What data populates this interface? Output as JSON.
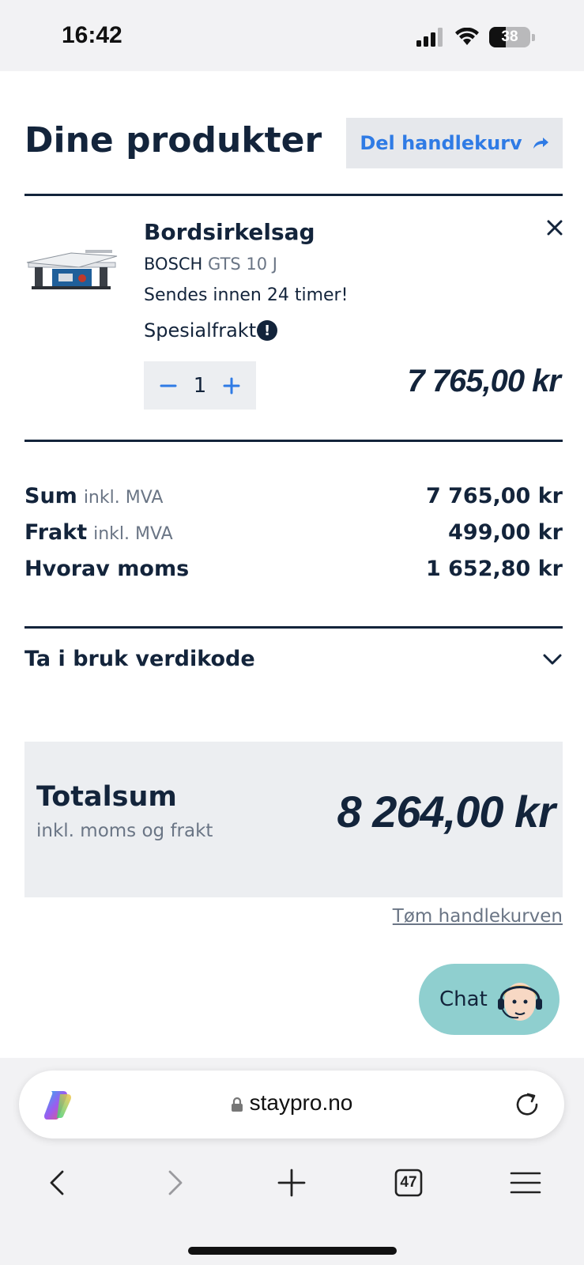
{
  "status": {
    "time": "16:42",
    "battery": "38"
  },
  "header": {
    "title": "Dine produkter",
    "share_label": "Del handlekurv"
  },
  "product": {
    "name": "Bordsirkelsag",
    "brand": "BOSCH",
    "model": "GTS 10 J",
    "shipping": "Sendes innen 24 timer!",
    "special": "Spesialfrakt",
    "quantity": "1",
    "price": "7 765,00 kr"
  },
  "summary": {
    "sum_label": "Sum",
    "sum_sub": "inkl. MVA",
    "sum_value": "7 765,00 kr",
    "freight_label": "Frakt",
    "freight_sub": "inkl. MVA",
    "freight_value": "499,00 kr",
    "vat_label": "Hvorav moms",
    "vat_value": "1 652,80 kr"
  },
  "voucher": {
    "label": "Ta i bruk verdikode"
  },
  "total": {
    "label": "Totalsum",
    "sub": "inkl. moms og frakt",
    "value": "8 264,00 kr"
  },
  "clear_cart": "Tøm handlekurven",
  "chat": {
    "label": "Chat"
  },
  "browser": {
    "url": "staypro.no",
    "tabs_count": "47"
  }
}
